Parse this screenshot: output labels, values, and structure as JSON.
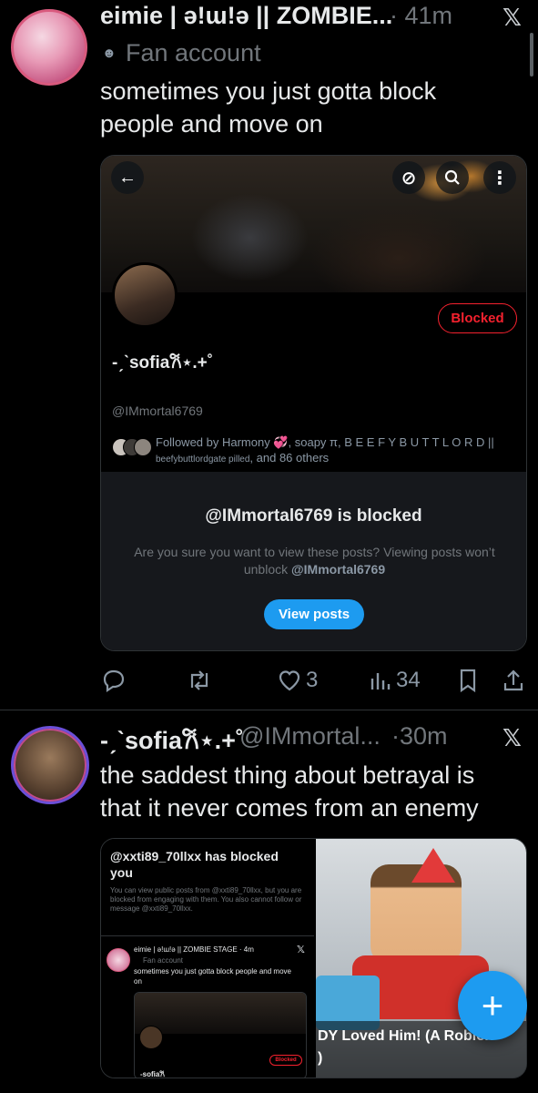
{
  "post1": {
    "display_name": "eimie | ə!ɯ!ə || ZOMBIE...",
    "time": "· 41m",
    "label_icon": "theater-mask-icon",
    "label": "Fan account",
    "text": "sometimes you just gotta block people and move on",
    "quote": {
      "back_icon": "back-arrow-icon",
      "top_icons": [
        "no-retweet-icon",
        "search-icon",
        "more-icon"
      ],
      "blocked_button": "Blocked",
      "profile_name": "-ˏˋsofia𐙚⋆.+˚",
      "handle": "@IMmortal6769",
      "followed_by_line1": "Followed by Harmony 💞, soapy π, B E E F Y B U T T L O R D ||",
      "followed_by_line2_small": "beefybuttlordgate pilled",
      "followed_by_line2_rest": ", and 86 others",
      "blocked_title": "@IMmortal6769 is blocked",
      "blocked_desc": "Are you sure you want to view these posts? Viewing posts won’t unblock",
      "blocked_desc_handle": "@IMmortal6769",
      "view_posts": "View posts"
    },
    "actions": {
      "reply": "",
      "repost": "",
      "likes": "3",
      "views": "34"
    }
  },
  "post2": {
    "display_name": "-ˏˋsofia𐙚⋆.+˚",
    "handle": "@IMmortal...",
    "time": "·30m",
    "text": "the saddest thing about betrayal is that it never comes from an enemy",
    "quote_left": {
      "title": "@xxti89_70llxx has blocked you",
      "desc": "You can view public posts from @xxti89_70llxx, but you are blocked from engaging with them. You also cannot follow or message @xxti89_70llxx.",
      "mini_name": "eimie | ə!ɯ!ə || ZOMBIE STAGE · 4m",
      "mini_label": "Fan account",
      "mini_text": "sometimes you just gotta block people and move on",
      "mini_blocked": "Blocked",
      "mini_profile": "-sofia𐙚"
    },
    "quote_right": {
      "caption": "DY Loved Him! (A Roblox"
    }
  },
  "fab_label": "+",
  "colors": {
    "accent": "#1d9bf0",
    "blocked": "#f4212e",
    "text": "#e7e9ea",
    "muted": "#71767b"
  }
}
